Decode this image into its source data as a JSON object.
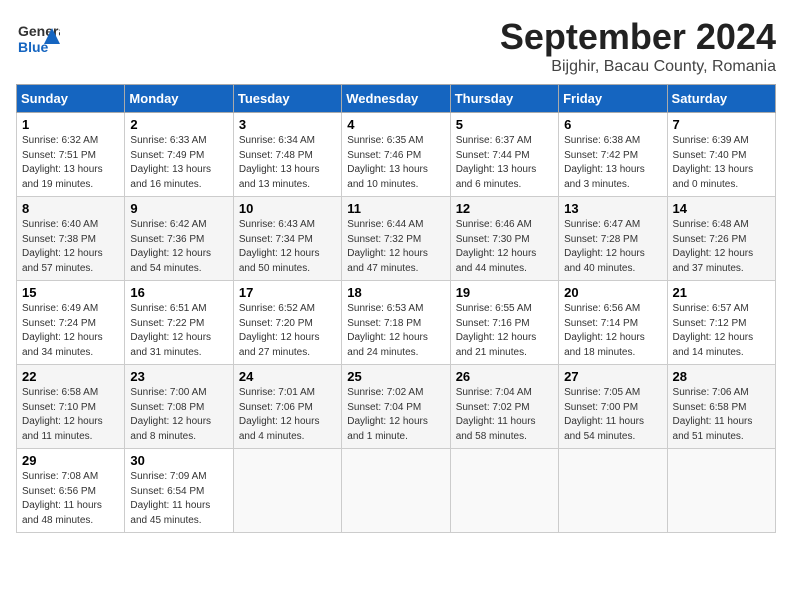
{
  "logo": {
    "line1": "General",
    "line2": "Blue"
  },
  "title": "September 2024",
  "subtitle": "Bijghir, Bacau County, Romania",
  "headers": [
    "Sunday",
    "Monday",
    "Tuesday",
    "Wednesday",
    "Thursday",
    "Friday",
    "Saturday"
  ],
  "weeks": [
    [
      {
        "day": "1",
        "info": "Sunrise: 6:32 AM\nSunset: 7:51 PM\nDaylight: 13 hours\nand 19 minutes."
      },
      {
        "day": "2",
        "info": "Sunrise: 6:33 AM\nSunset: 7:49 PM\nDaylight: 13 hours\nand 16 minutes."
      },
      {
        "day": "3",
        "info": "Sunrise: 6:34 AM\nSunset: 7:48 PM\nDaylight: 13 hours\nand 13 minutes."
      },
      {
        "day": "4",
        "info": "Sunrise: 6:35 AM\nSunset: 7:46 PM\nDaylight: 13 hours\nand 10 minutes."
      },
      {
        "day": "5",
        "info": "Sunrise: 6:37 AM\nSunset: 7:44 PM\nDaylight: 13 hours\nand 6 minutes."
      },
      {
        "day": "6",
        "info": "Sunrise: 6:38 AM\nSunset: 7:42 PM\nDaylight: 13 hours\nand 3 minutes."
      },
      {
        "day": "7",
        "info": "Sunrise: 6:39 AM\nSunset: 7:40 PM\nDaylight: 13 hours\nand 0 minutes."
      }
    ],
    [
      {
        "day": "8",
        "info": "Sunrise: 6:40 AM\nSunset: 7:38 PM\nDaylight: 12 hours\nand 57 minutes."
      },
      {
        "day": "9",
        "info": "Sunrise: 6:42 AM\nSunset: 7:36 PM\nDaylight: 12 hours\nand 54 minutes."
      },
      {
        "day": "10",
        "info": "Sunrise: 6:43 AM\nSunset: 7:34 PM\nDaylight: 12 hours\nand 50 minutes."
      },
      {
        "day": "11",
        "info": "Sunrise: 6:44 AM\nSunset: 7:32 PM\nDaylight: 12 hours\nand 47 minutes."
      },
      {
        "day": "12",
        "info": "Sunrise: 6:46 AM\nSunset: 7:30 PM\nDaylight: 12 hours\nand 44 minutes."
      },
      {
        "day": "13",
        "info": "Sunrise: 6:47 AM\nSunset: 7:28 PM\nDaylight: 12 hours\nand 40 minutes."
      },
      {
        "day": "14",
        "info": "Sunrise: 6:48 AM\nSunset: 7:26 PM\nDaylight: 12 hours\nand 37 minutes."
      }
    ],
    [
      {
        "day": "15",
        "info": "Sunrise: 6:49 AM\nSunset: 7:24 PM\nDaylight: 12 hours\nand 34 minutes."
      },
      {
        "day": "16",
        "info": "Sunrise: 6:51 AM\nSunset: 7:22 PM\nDaylight: 12 hours\nand 31 minutes."
      },
      {
        "day": "17",
        "info": "Sunrise: 6:52 AM\nSunset: 7:20 PM\nDaylight: 12 hours\nand 27 minutes."
      },
      {
        "day": "18",
        "info": "Sunrise: 6:53 AM\nSunset: 7:18 PM\nDaylight: 12 hours\nand 24 minutes."
      },
      {
        "day": "19",
        "info": "Sunrise: 6:55 AM\nSunset: 7:16 PM\nDaylight: 12 hours\nand 21 minutes."
      },
      {
        "day": "20",
        "info": "Sunrise: 6:56 AM\nSunset: 7:14 PM\nDaylight: 12 hours\nand 18 minutes."
      },
      {
        "day": "21",
        "info": "Sunrise: 6:57 AM\nSunset: 7:12 PM\nDaylight: 12 hours\nand 14 minutes."
      }
    ],
    [
      {
        "day": "22",
        "info": "Sunrise: 6:58 AM\nSunset: 7:10 PM\nDaylight: 12 hours\nand 11 minutes."
      },
      {
        "day": "23",
        "info": "Sunrise: 7:00 AM\nSunset: 7:08 PM\nDaylight: 12 hours\nand 8 minutes."
      },
      {
        "day": "24",
        "info": "Sunrise: 7:01 AM\nSunset: 7:06 PM\nDaylight: 12 hours\nand 4 minutes."
      },
      {
        "day": "25",
        "info": "Sunrise: 7:02 AM\nSunset: 7:04 PM\nDaylight: 12 hours\nand 1 minute."
      },
      {
        "day": "26",
        "info": "Sunrise: 7:04 AM\nSunset: 7:02 PM\nDaylight: 11 hours\nand 58 minutes."
      },
      {
        "day": "27",
        "info": "Sunrise: 7:05 AM\nSunset: 7:00 PM\nDaylight: 11 hours\nand 54 minutes."
      },
      {
        "day": "28",
        "info": "Sunrise: 7:06 AM\nSunset: 6:58 PM\nDaylight: 11 hours\nand 51 minutes."
      }
    ],
    [
      {
        "day": "29",
        "info": "Sunrise: 7:08 AM\nSunset: 6:56 PM\nDaylight: 11 hours\nand 48 minutes."
      },
      {
        "day": "30",
        "info": "Sunrise: 7:09 AM\nSunset: 6:54 PM\nDaylight: 11 hours\nand 45 minutes."
      },
      {
        "day": "",
        "info": ""
      },
      {
        "day": "",
        "info": ""
      },
      {
        "day": "",
        "info": ""
      },
      {
        "day": "",
        "info": ""
      },
      {
        "day": "",
        "info": ""
      }
    ]
  ]
}
